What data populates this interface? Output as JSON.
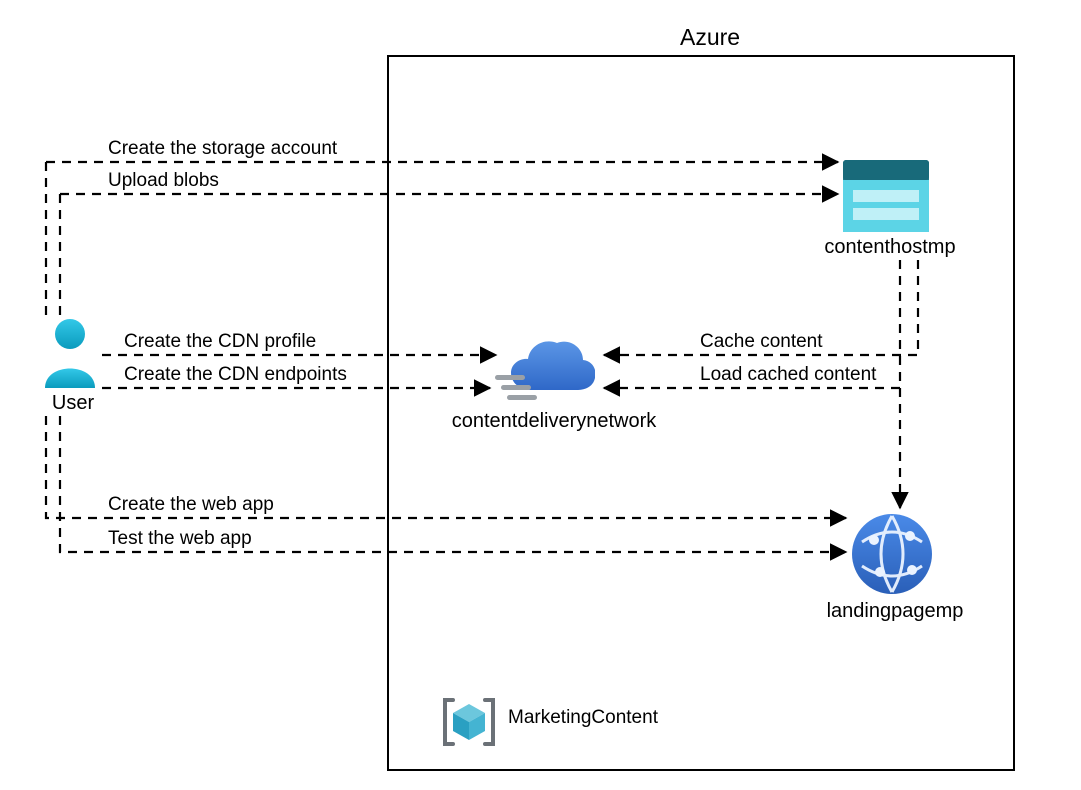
{
  "title": "Azure",
  "nodes": {
    "user": "User",
    "storage": "contenthostmp",
    "cdn": "contentdeliverynetwork",
    "webapp": "landingpagemp",
    "rg": "MarketingContent"
  },
  "edges": {
    "create_storage": "Create the storage account",
    "upload_blobs": "Upload blobs",
    "create_cdn_profile": "Create the CDN profile",
    "create_cdn_endpoints": "Create the CDN endpoints",
    "cache_content": "Cache content",
    "load_cached_content": "Load cached content",
    "create_web_app": "Create the web app",
    "test_web_app": "Test the web app"
  }
}
